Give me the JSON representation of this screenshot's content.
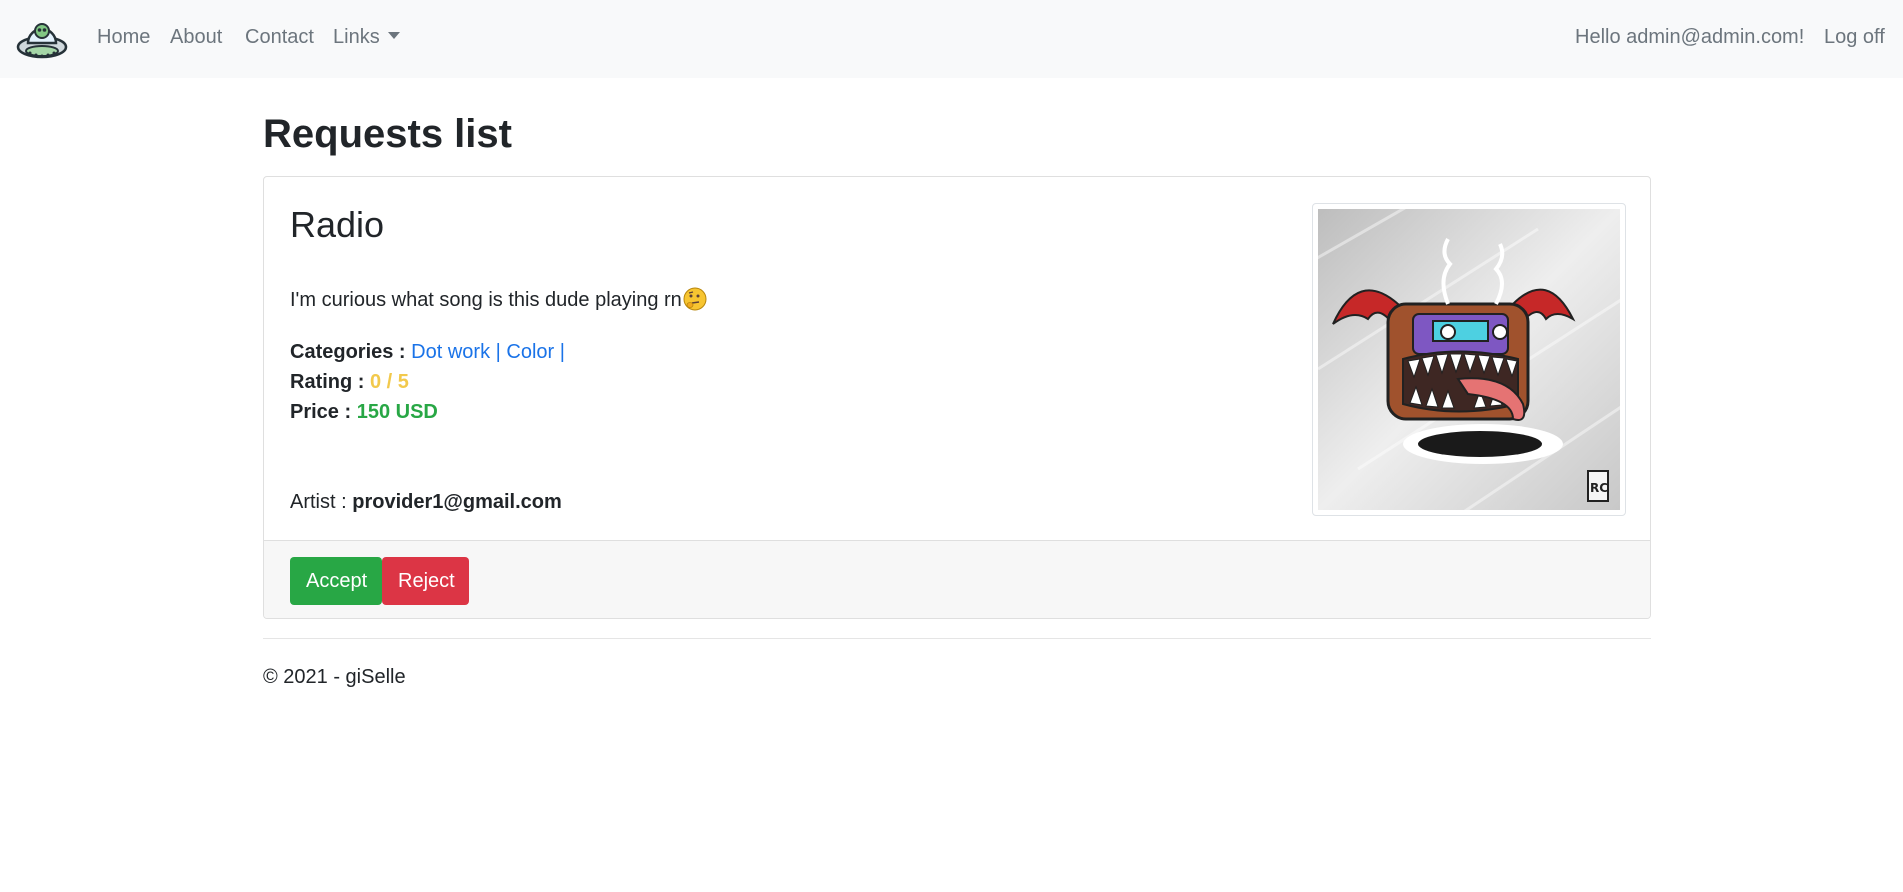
{
  "nav": {
    "logo_icon": "ufo-alien-icon",
    "home": "Home",
    "about": "About",
    "contact": "Contact",
    "links": "Links",
    "greeting": "Hello admin@admin.com!",
    "logoff": "Log off"
  },
  "page": {
    "title": "Requests list"
  },
  "request": {
    "title": "Radio",
    "description": "I'm curious what song is this dude playing rn",
    "description_emoji": "thinking-face-icon",
    "categories_label": "Categories :",
    "categories": [
      "Dot work |",
      "Color |"
    ],
    "rating_label": "Rating :",
    "rating": "0 / 5",
    "price_label": "Price :",
    "price": "150 USD",
    "artist_label": "Artist :",
    "artist": "provider1@gmail.com",
    "image_icon": "radio-monster-artwork"
  },
  "actions": {
    "accept": "Accept",
    "reject": "Reject"
  },
  "footer": {
    "copyright": "© 2021 - giSelle"
  },
  "colors": {
    "accept": "#28a745",
    "reject": "#dc3545",
    "link": "#1a73e8",
    "rating": "#f2c94c",
    "price": "#28a745",
    "navbar_bg": "#f8f9fa"
  }
}
